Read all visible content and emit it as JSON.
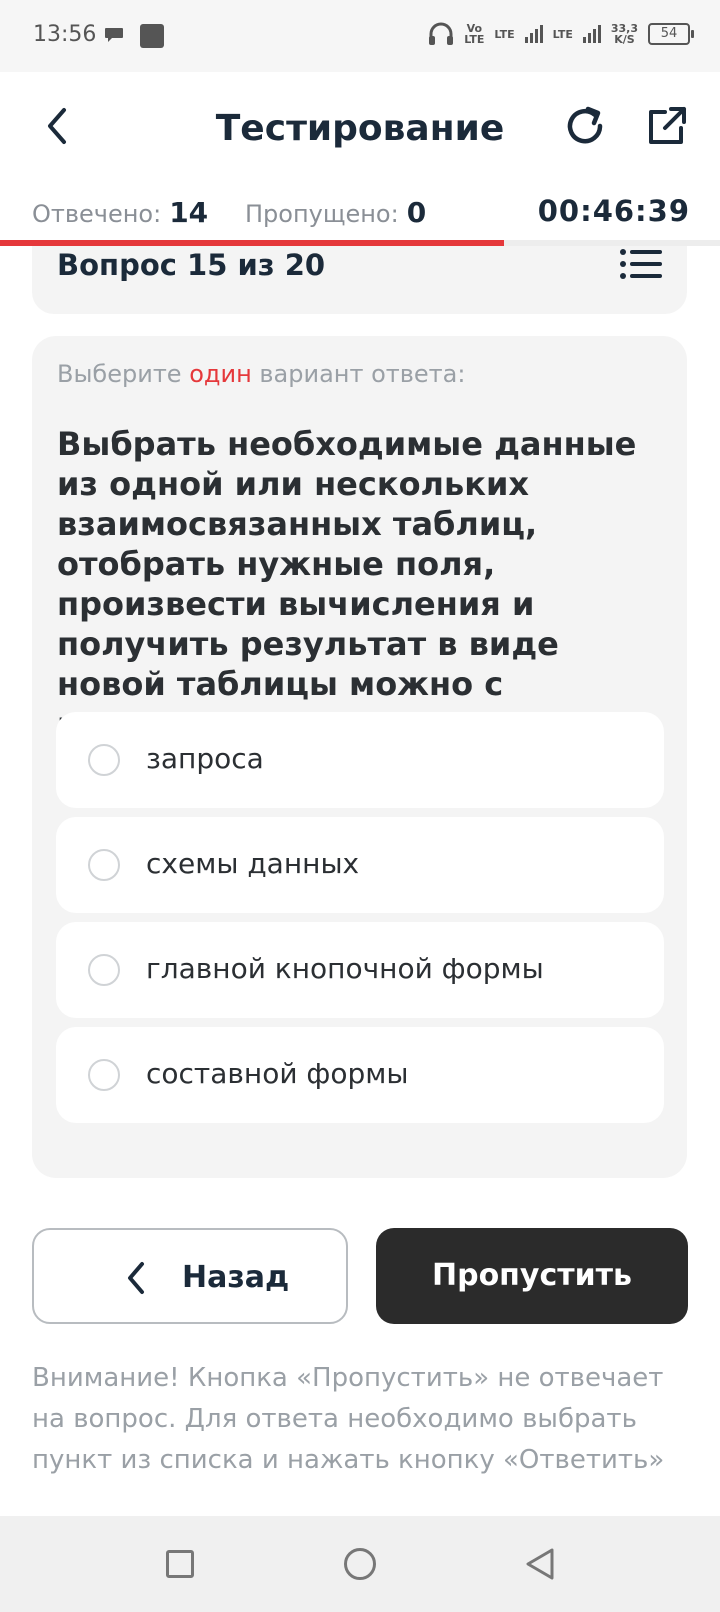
{
  "status_bar": {
    "time": "13:56",
    "network_volte": "Vo\nLTE",
    "lte1": "LTE",
    "lte2": "LTE",
    "speed_value": "33,3",
    "speed_unit": "K/S",
    "battery": "54"
  },
  "header": {
    "title": "Тестирование"
  },
  "counters": {
    "answered_label": "Отвечено:",
    "answered_value": "14",
    "skipped_label": "Пропущено:",
    "skipped_value": "0",
    "timer": "00:46:39",
    "progress": 0.7
  },
  "question": {
    "counter": "Вопрос 15 из 20",
    "hint_before": "Выберите ",
    "hint_accent": "один",
    "hint_after": " вариант ответа:",
    "text": "Выбрать необходимые данные из одной или нескольких взаимосвязанных таблиц, отобрать нужные поля, произвести вычисления и получить результат в виде новой таблицы можно с помощью ...",
    "options": [
      {
        "label": "запроса",
        "selected": false
      },
      {
        "label": "схемы данных",
        "selected": false
      },
      {
        "label": "главной кнопочной формы",
        "selected": false
      },
      {
        "label": "составной формы",
        "selected": false
      }
    ]
  },
  "buttons": {
    "back_label": "Назад",
    "skip_label": "Пропустить"
  },
  "warning": "Внимание! Кнопка «Пропустить» не отвечает на вопрос. Для ответа необходимо выбрать пункт из списка и нажать кнопку «Ответить»",
  "colors": {
    "accent": "#e5383b",
    "dark_button": "#2b2b2b",
    "card_bg": "#f4f4f4",
    "title_text": "#1b2a3a"
  },
  "icons": {
    "back": "chevron-left-icon",
    "refresh": "refresh-icon",
    "share": "external-link-icon",
    "question_list": "list-icon"
  }
}
